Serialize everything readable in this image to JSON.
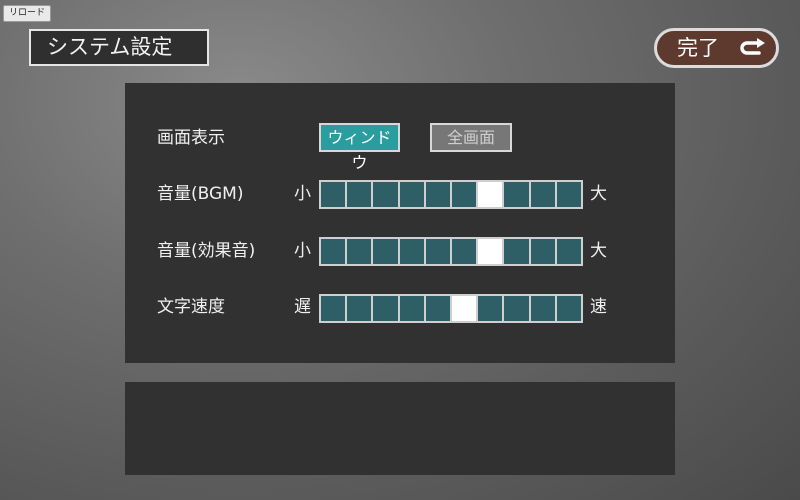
{
  "reload_button": "リロード",
  "title": "システム設定",
  "done_button": "完了",
  "display": {
    "label": "画面表示",
    "options": [
      "ウィンドウ",
      "全画面"
    ],
    "selected": "ウィンドウ"
  },
  "sliders": [
    {
      "label": "音量(BGM)",
      "min_label": "小",
      "max_label": "大",
      "level": 7,
      "steps": 10
    },
    {
      "label": "音量(効果音)",
      "min_label": "小",
      "max_label": "大",
      "level": 7,
      "steps": 10
    },
    {
      "label": "文字速度",
      "min_label": "遅",
      "max_label": "速",
      "level": 6,
      "steps": 10
    }
  ],
  "colors": {
    "selected_option": "#2a9d9f",
    "slider_segment": "#2f5f66",
    "slider_knob": "#ffffff",
    "done_button_bg": "#5e3a2e"
  },
  "icons": {
    "done": "return-arrow-icon"
  }
}
